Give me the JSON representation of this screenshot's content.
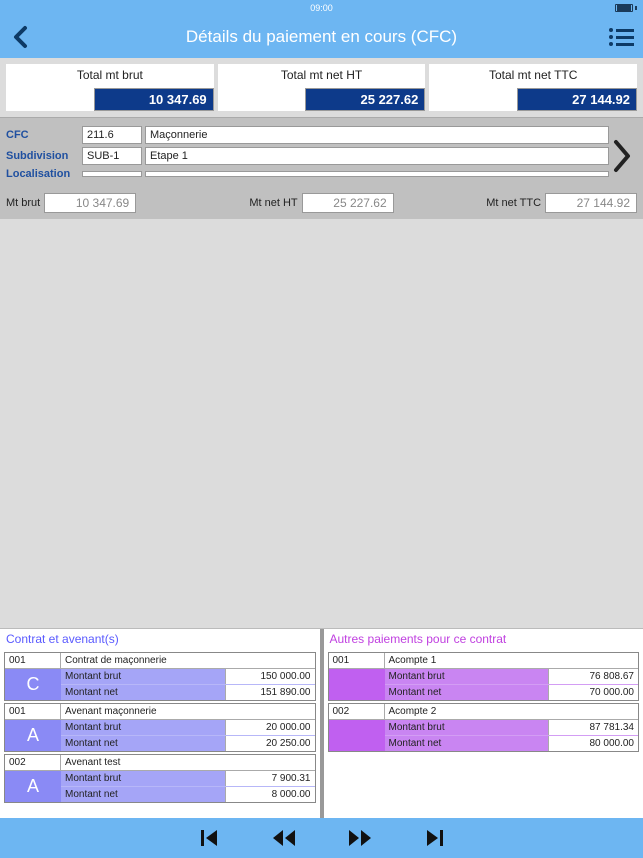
{
  "status": {
    "time": "09:00"
  },
  "header": {
    "title": "Détails du paiement en cours (CFC)"
  },
  "totals": {
    "brut_label": "Total mt brut",
    "brut_value": "10 347.69",
    "netht_label": "Total mt net HT",
    "netht_value": "25 227.62",
    "netttc_label": "Total mt net TTC",
    "netttc_value": "27 144.92"
  },
  "details": {
    "cfc_label": "CFC",
    "cfc_code": "211.6",
    "cfc_name": "Maçonnerie",
    "sub_label": "Subdivision",
    "sub_code": "SUB-1",
    "sub_name": "Etape 1",
    "loc_label": "Localisation",
    "loc_code": "",
    "loc_name": ""
  },
  "amounts": {
    "brut_label": "Mt brut",
    "brut_value": "10 347.69",
    "netht_label": "Mt net HT",
    "netht_value": "25 227.62",
    "netttc_label": "Mt net TTC",
    "netttc_value": "27 144.92"
  },
  "bottom": {
    "left_title": "Contrat et avenant(s)",
    "right_title": "Autres paiements pour ce contrat",
    "left": [
      {
        "num": "001",
        "title": "Contrat de maçonnerie",
        "tag": "C",
        "rows": [
          {
            "label": "Montant brut",
            "value": "150 000.00"
          },
          {
            "label": "Montant net",
            "value": "151 890.00"
          }
        ]
      },
      {
        "num": "001",
        "title": "Avenant maçonnerie",
        "tag": "A",
        "rows": [
          {
            "label": "Montant brut",
            "value": "20 000.00"
          },
          {
            "label": "Montant net",
            "value": "20 250.00"
          }
        ]
      },
      {
        "num": "002",
        "title": "Avenant test",
        "tag": "A",
        "rows": [
          {
            "label": "Montant brut",
            "value": "7 900.31"
          },
          {
            "label": "Montant net",
            "value": "8 000.00"
          }
        ]
      }
    ],
    "right": [
      {
        "num": "001",
        "title": "Acompte 1",
        "tag": " ",
        "rows": [
          {
            "label": "Montant brut",
            "value": "76 808.67"
          },
          {
            "label": "Montant net",
            "value": "70 000.00"
          }
        ]
      },
      {
        "num": "002",
        "title": "Acompte 2",
        "tag": " ",
        "rows": [
          {
            "label": "Montant brut",
            "value": "87 781.34"
          },
          {
            "label": "Montant net",
            "value": "80 000.00"
          }
        ]
      }
    ]
  }
}
